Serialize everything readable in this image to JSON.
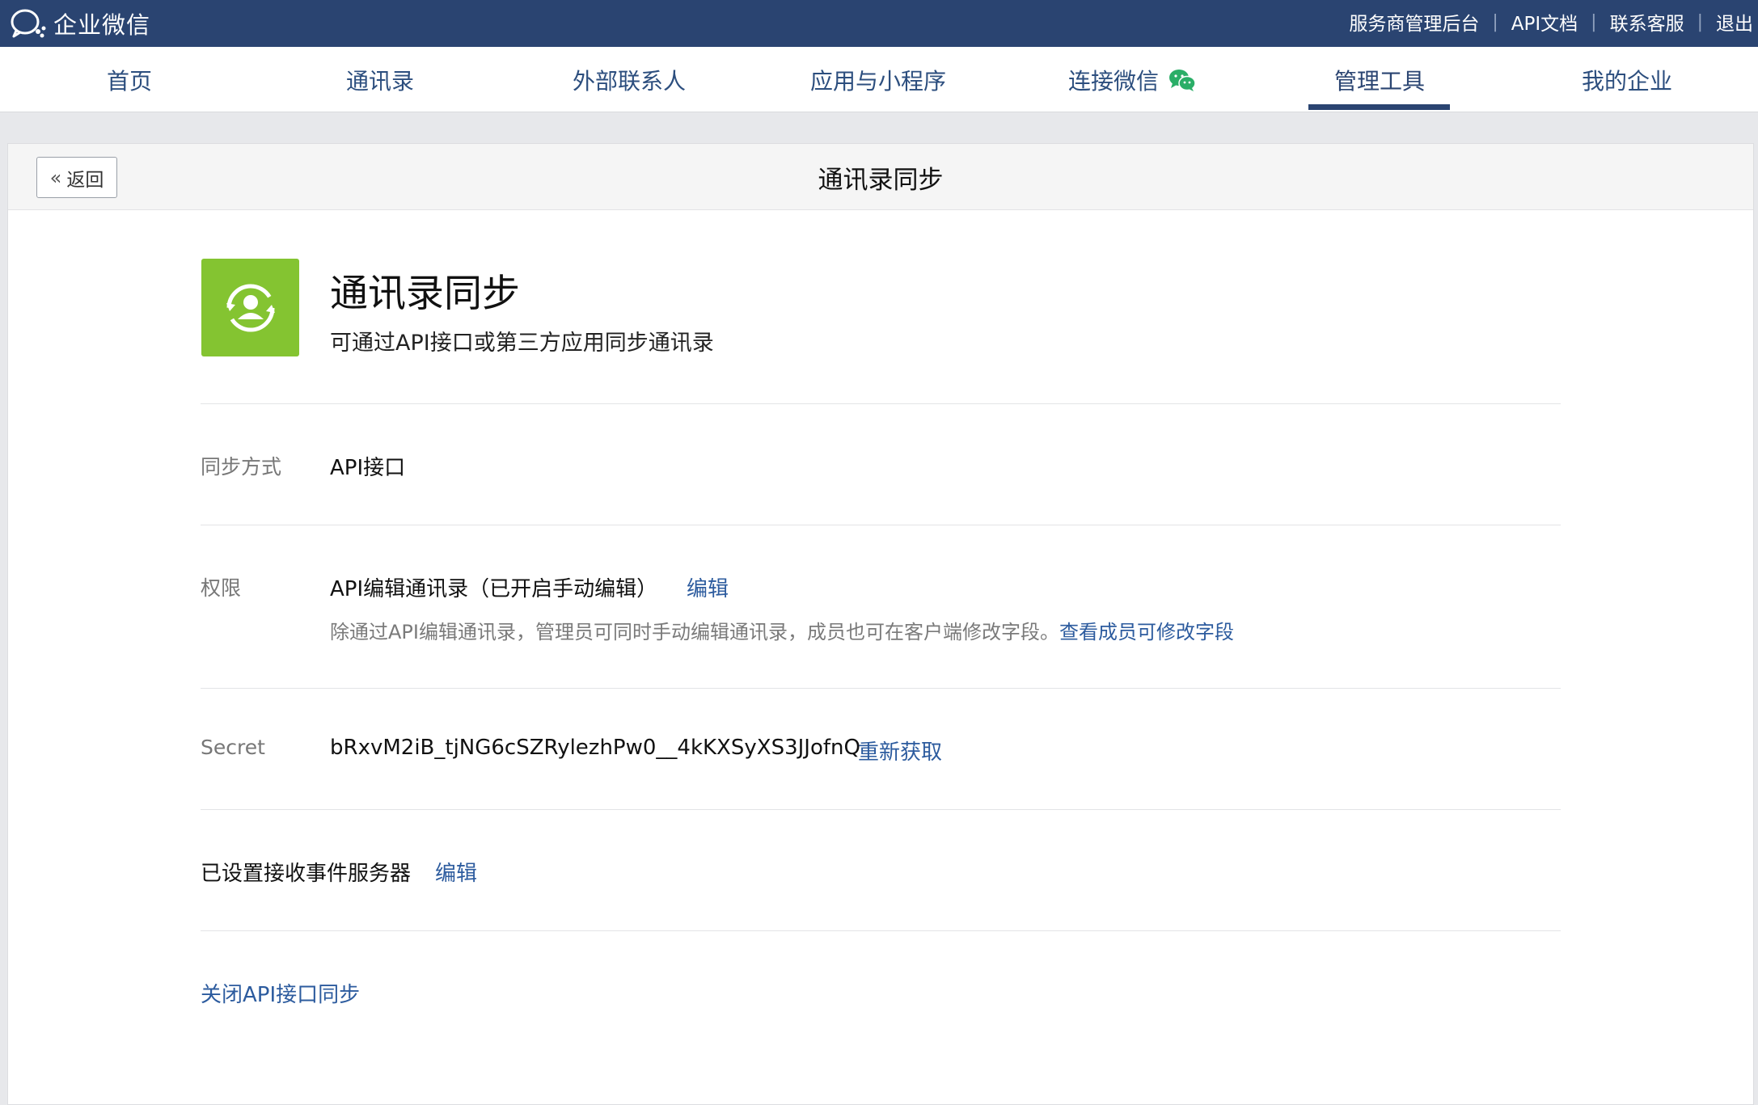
{
  "topbar": {
    "logo_text": "企业微信",
    "links": [
      "服务商管理后台",
      "API文档",
      "联系客服",
      "退出"
    ]
  },
  "nav": {
    "items": [
      "首页",
      "通讯录",
      "外部联系人",
      "应用与小程序",
      "连接微信",
      "管理工具",
      "我的企业"
    ],
    "active": "管理工具"
  },
  "header": {
    "back_label": "返回",
    "title": "通讯录同步"
  },
  "app": {
    "title": "通讯录同步",
    "description": "可通过API接口或第三方应用同步通讯录"
  },
  "sync_method": {
    "label": "同步方式",
    "value": "API接口"
  },
  "permission": {
    "label": "权限",
    "value": "API编辑通讯录（已开启手动编辑）",
    "edit_link": "编辑",
    "hint": "除通过API编辑通讯录，管理员可同时手动编辑通讯录，成员也可在客户端修改字段。",
    "hint_link": "查看成员可修改字段"
  },
  "secret": {
    "label": "Secret",
    "value": "bRxvM2iB_tjNG6cSZRylezhPw0__4kKXSyXS3JJofnQ",
    "refresh_link": "重新获取"
  },
  "event_server": {
    "label": "已设置接收事件服务器",
    "edit_link": "编辑"
  },
  "close_link": "关闭API接口同步",
  "colors": {
    "topbar": "#2a4471",
    "link": "#2c5b9e",
    "app_icon": "#84c431",
    "wechat_green": "#2aae67"
  }
}
